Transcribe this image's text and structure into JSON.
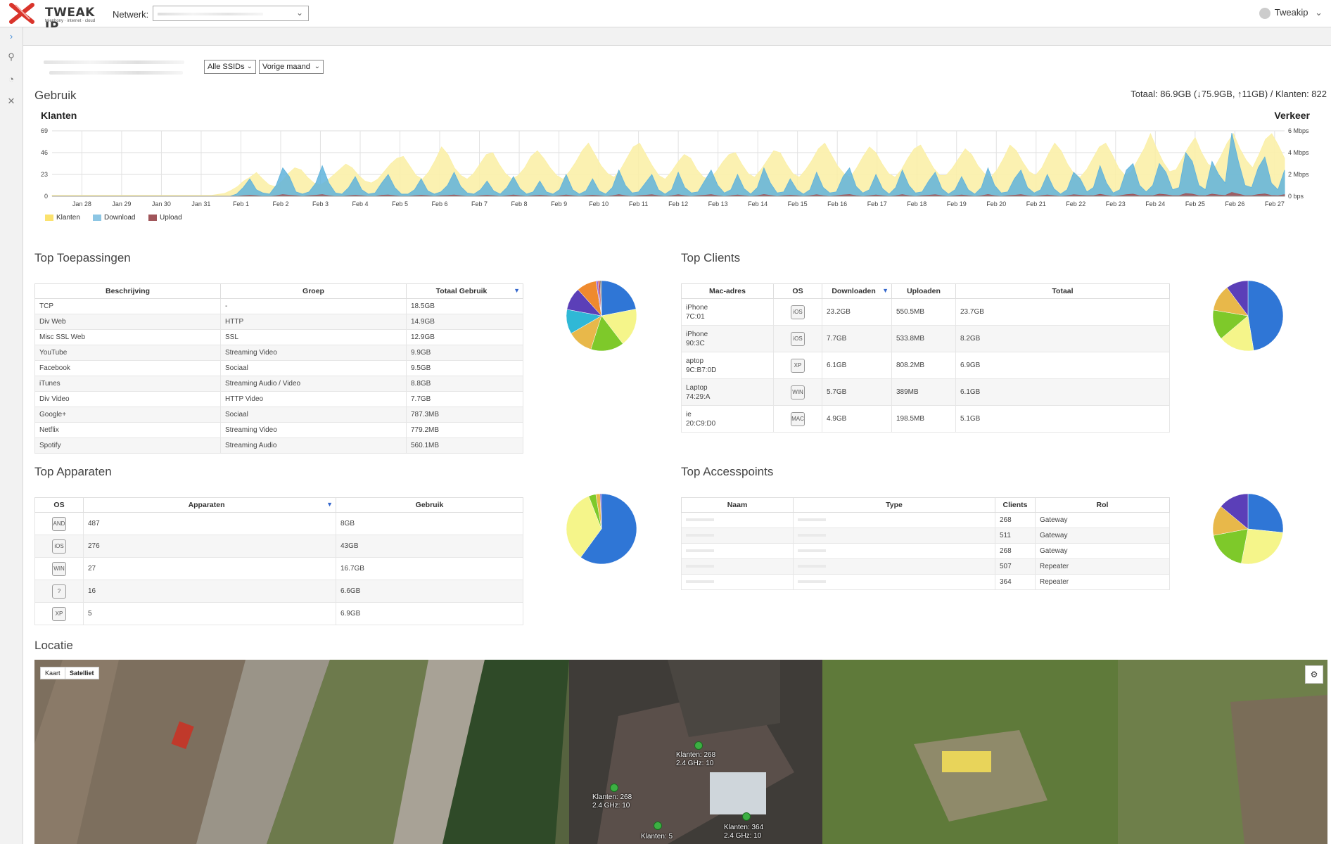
{
  "header": {
    "logo_text": "TWEAK IP",
    "logo_sub": "telephony · internet · cloud",
    "network_label": "Netwerk:",
    "user_name": "Tweakip"
  },
  "filters": {
    "ssid": "Alle SSIDs",
    "period": "Vorige maand"
  },
  "usage": {
    "title": "Gebruik",
    "totals": "Totaal: 86.9GB (↓75.9GB, ↑11GB) / Klanten: 822"
  },
  "chart_data": {
    "type": "area",
    "title": "",
    "left_axis_label": "Klanten",
    "right_axis_label": "Verkeer",
    "left_ticks": [
      "69",
      "46",
      "23",
      "0"
    ],
    "right_ticks": [
      "6 Mbps",
      "4 Mbps",
      "2 Mbps",
      "0 bps"
    ],
    "ylim_left": [
      0,
      69
    ],
    "ylim_right_mbps": [
      0,
      6
    ],
    "x_labels": [
      "Jan 28",
      "Jan 29",
      "Jan 30",
      "Jan 31",
      "Feb 1",
      "Feb 2",
      "Feb 3",
      "Feb 4",
      "Feb 5",
      "Feb 6",
      "Feb 7",
      "Feb 8",
      "Feb 9",
      "Feb 10",
      "Feb 11",
      "Feb 12",
      "Feb 13",
      "Feb 14",
      "Feb 15",
      "Feb 16",
      "Feb 17",
      "Feb 18",
      "Feb 19",
      "Feb 20",
      "Feb 21",
      "Feb 22",
      "Feb 23",
      "Feb 24",
      "Feb 25",
      "Feb 26",
      "Feb 27"
    ],
    "series": [
      {
        "name": "Klanten",
        "color": "#fbf0a8",
        "values": [
          1,
          1,
          1,
          1,
          1,
          1,
          1,
          1,
          1,
          1,
          1,
          1,
          1,
          1,
          1,
          1,
          1,
          1,
          1,
          1,
          1,
          1,
          1,
          1,
          1,
          1,
          2,
          3,
          6,
          10,
          16,
          20,
          25,
          18,
          12,
          10,
          16,
          24,
          30,
          28,
          20,
          14,
          12,
          16,
          22,
          28,
          34,
          30,
          22,
          16,
          14,
          18,
          26,
          34,
          40,
          42,
          32,
          22,
          18,
          26,
          38,
          52,
          44,
          30,
          22,
          18,
          24,
          34,
          44,
          46,
          34,
          24,
          18,
          22,
          30,
          42,
          48,
          40,
          30,
          22,
          18,
          26,
          36,
          48,
          56,
          44,
          32,
          24,
          20,
          28,
          40,
          52,
          56,
          44,
          32,
          22,
          18,
          26,
          36,
          44,
          40,
          28,
          20,
          18,
          26,
          36,
          44,
          46,
          34,
          24,
          20,
          28,
          38,
          48,
          46,
          34,
          24,
          20,
          28,
          38,
          50,
          56,
          44,
          32,
          24,
          20,
          30,
          42,
          52,
          46,
          34,
          24,
          20,
          28,
          40,
          50,
          54,
          42,
          30,
          22,
          22,
          30,
          40,
          50,
          44,
          32,
          24,
          20,
          28,
          40,
          54,
          48,
          36,
          26,
          22,
          30,
          44,
          56,
          48,
          34,
          24,
          20,
          28,
          40,
          52,
          56,
          44,
          30,
          22,
          26,
          38,
          50,
          66,
          50,
          36,
          26,
          28,
          40,
          52,
          62,
          46,
          34,
          30,
          42,
          56,
          66,
          50,
          38,
          30,
          44,
          60,
          66,
          54,
          40
        ]
      },
      {
        "name": "Download",
        "color": "#9fcfe8",
        "values": [
          0,
          0,
          0,
          0,
          0,
          0,
          0,
          0,
          0,
          0,
          0,
          0,
          0,
          0,
          0,
          0,
          0,
          0,
          0,
          0,
          0,
          0,
          0,
          0,
          0,
          0,
          0,
          0,
          0.2,
          0.8,
          1.6,
          0.6,
          0.3,
          0.2,
          1.0,
          2.6,
          1.8,
          0.4,
          0.2,
          0.4,
          1.2,
          2.8,
          1.2,
          0.3,
          0.2,
          0.8,
          1.8,
          0.6,
          0.2,
          0.3,
          1.2,
          2.0,
          0.8,
          0.2,
          0.2,
          0.6,
          1.6,
          0.5,
          0.2,
          0.4,
          1.0,
          2.2,
          0.9,
          0.3,
          0.2,
          0.6,
          1.4,
          0.5,
          0.2,
          0.8,
          1.8,
          0.7,
          0.2,
          0.4,
          1.4,
          0.4,
          0.2,
          0.6,
          2.0,
          0.6,
          0.2,
          0.5,
          1.6,
          0.5,
          0.2,
          0.8,
          2.4,
          1.0,
          0.3,
          0.4,
          1.2,
          2.0,
          0.6,
          0.2,
          0.6,
          2.2,
          0.8,
          0.3,
          0.4,
          1.4,
          2.4,
          1.0,
          0.3,
          0.6,
          2.0,
          0.7,
          0.2,
          0.8,
          2.6,
          1.2,
          0.3,
          0.4,
          1.6,
          0.6,
          0.2,
          0.6,
          2.2,
          0.8,
          0.3,
          0.4,
          1.8,
          2.6,
          0.9,
          0.3,
          0.6,
          2.0,
          0.7,
          0.2,
          0.8,
          2.4,
          1.0,
          0.3,
          0.4,
          1.4,
          2.2,
          0.7,
          0.2,
          0.6,
          1.8,
          0.6,
          0.2,
          0.8,
          2.6,
          1.0,
          0.3,
          0.4,
          1.6,
          2.4,
          0.8,
          0.3,
          0.6,
          2.0,
          0.7,
          0.2,
          0.6,
          2.2,
          1.6,
          0.4,
          0.8,
          2.8,
          1.2,
          0.3,
          0.6,
          2.4,
          3.0,
          1.0,
          0.4,
          1.0,
          3.0,
          2.2,
          0.6,
          0.8,
          4.0,
          3.2,
          1.0,
          0.6,
          3.2,
          2.0,
          1.2,
          5.8,
          3.2,
          1.0,
          0.8,
          2.6,
          3.6,
          1.2,
          0.6,
          2.4
        ]
      },
      {
        "name": "Upload",
        "color": "#a0555a",
        "values": [
          0,
          0,
          0,
          0,
          0,
          0,
          0,
          0,
          0,
          0,
          0,
          0,
          0,
          0,
          0,
          0,
          0,
          0,
          0,
          0,
          0,
          0,
          0,
          0,
          0,
          0,
          0,
          0,
          0,
          0.05,
          0.1,
          0.05,
          0,
          0,
          0.05,
          0.15,
          0.1,
          0.05,
          0,
          0.05,
          0.1,
          0.15,
          0.05,
          0,
          0,
          0.05,
          0.1,
          0.05,
          0,
          0,
          0.1,
          0.12,
          0.05,
          0,
          0,
          0.05,
          0.1,
          0.05,
          0,
          0.05,
          0.08,
          0.12,
          0.05,
          0,
          0,
          0.05,
          0.1,
          0.05,
          0,
          0.05,
          0.12,
          0.05,
          0,
          0.05,
          0.1,
          0.05,
          0,
          0.05,
          0.12,
          0.05,
          0,
          0.05,
          0.1,
          0.05,
          0,
          0.05,
          0.15,
          0.06,
          0,
          0.05,
          0.1,
          0.14,
          0.05,
          0,
          0.05,
          0.14,
          0.05,
          0,
          0.05,
          0.1,
          0.15,
          0.06,
          0,
          0.05,
          0.12,
          0.05,
          0,
          0.05,
          0.16,
          0.08,
          0,
          0.05,
          0.1,
          0.05,
          0,
          0.05,
          0.14,
          0.05,
          0,
          0.05,
          0.12,
          0.16,
          0.06,
          0,
          0.05,
          0.12,
          0.05,
          0,
          0.05,
          0.15,
          0.06,
          0,
          0.05,
          0.1,
          0.14,
          0.05,
          0,
          0.05,
          0.12,
          0.05,
          0,
          0.05,
          0.16,
          0.06,
          0,
          0.05,
          0.1,
          0.15,
          0.05,
          0,
          0.05,
          0.12,
          0.05,
          0,
          0.05,
          0.14,
          0.1,
          0.05,
          0.05,
          0.18,
          0.08,
          0,
          0.05,
          0.15,
          0.2,
          0.06,
          0.05,
          0.06,
          0.2,
          0.14,
          0.05,
          0.06,
          0.25,
          0.2,
          0.06,
          0.05,
          0.2,
          0.12,
          0.08,
          0.35,
          0.2,
          0.06,
          0.05,
          0.16,
          0.22,
          0.08,
          0.05,
          0.15
        ]
      }
    ],
    "legend_placement": "bottom-left",
    "grid": true
  },
  "apps": {
    "title": "Top Toepassingen",
    "columns": [
      "Beschrijving",
      "Groep",
      "Totaal Gebruik"
    ],
    "rows": [
      [
        "TCP",
        "-",
        "18.5GB"
      ],
      [
        "Div Web",
        "HTTP",
        "14.9GB"
      ],
      [
        "Misc SSL Web",
        "SSL",
        "12.9GB"
      ],
      [
        "YouTube",
        "Streaming Video",
        "9.9GB"
      ],
      [
        "Facebook",
        "Sociaal",
        "9.5GB"
      ],
      [
        "iTunes",
        "Streaming Audio / Video",
        "8.8GB"
      ],
      [
        "Div Video",
        "HTTP Video",
        "7.7GB"
      ],
      [
        "Google+",
        "Sociaal",
        "787.3MB"
      ],
      [
        "Netflix",
        "Streaming Video",
        "779.2MB"
      ],
      [
        "Spotify",
        "Streaming Audio",
        "560.1MB"
      ]
    ],
    "pie": [
      {
        "value": 18.5,
        "color": "#2f76d6"
      },
      {
        "value": 14.9,
        "color": "#f5f58a"
      },
      {
        "value": 12.9,
        "color": "#7ec92a"
      },
      {
        "value": 9.9,
        "color": "#e8b84a"
      },
      {
        "value": 9.5,
        "color": "#2fb8d6"
      },
      {
        "value": 8.8,
        "color": "#5b3fb8"
      },
      {
        "value": 7.7,
        "color": "#ef8a2e"
      },
      {
        "value": 0.79,
        "color": "#9a6ad6"
      },
      {
        "value": 0.78,
        "color": "#c24a4a"
      },
      {
        "value": 0.56,
        "color": "#6a6a6a"
      }
    ]
  },
  "clients": {
    "title": "Top Clients",
    "columns": [
      "Mac-adres",
      "OS",
      "Downloaden",
      "Uploaden",
      "Totaal"
    ],
    "rows": [
      {
        "mac1": "iPhone",
        "mac2": "7C:01",
        "os": "iOS",
        "down": "23.2GB",
        "up": "550.5MB",
        "total": "23.7GB"
      },
      {
        "mac1": "iPhone",
        "mac2": "90:3C",
        "os": "iOS",
        "down": "7.7GB",
        "up": "533.8MB",
        "total": "8.2GB"
      },
      {
        "mac1": "aptop",
        "mac2": "9C:B7:0D",
        "os": "XP",
        "down": "6.1GB",
        "up": "808.2MB",
        "total": "6.9GB"
      },
      {
        "mac1": "Laptop",
        "mac2": "74:29:A",
        "os": "WIN",
        "down": "5.7GB",
        "up": "389MB",
        "total": "6.1GB"
      },
      {
        "mac1": "ie",
        "mac2": "20:C9:D0",
        "os": "MAC",
        "down": "4.9GB",
        "up": "198.5MB",
        "total": "5.1GB"
      }
    ],
    "pie": [
      {
        "value": 23.7,
        "color": "#2f76d6"
      },
      {
        "value": 8.2,
        "color": "#f5f58a"
      },
      {
        "value": 6.9,
        "color": "#7ec92a"
      },
      {
        "value": 6.1,
        "color": "#e8b84a"
      },
      {
        "value": 5.1,
        "color": "#5b3fb8"
      }
    ]
  },
  "devices": {
    "title": "Top Apparaten",
    "columns": [
      "OS",
      "Apparaten",
      "Gebruik"
    ],
    "rows": [
      {
        "os": "AND",
        "count": "487",
        "usage": "8GB"
      },
      {
        "os": "iOS",
        "count": "276",
        "usage": "43GB"
      },
      {
        "os": "WIN",
        "count": "27",
        "usage": "16.7GB"
      },
      {
        "os": "?",
        "count": "16",
        "usage": "6.6GB"
      },
      {
        "os": "XP",
        "count": "5",
        "usage": "6.9GB"
      }
    ],
    "pie": [
      {
        "value": 487,
        "color": "#2f76d6"
      },
      {
        "value": 276,
        "color": "#f5f58a"
      },
      {
        "value": 27,
        "color": "#7ec92a"
      },
      {
        "value": 16,
        "color": "#e8b84a"
      },
      {
        "value": 5,
        "color": "#5b3fb8"
      }
    ]
  },
  "accesspoints": {
    "title": "Top Accesspoints",
    "columns": [
      "Naam",
      "Type",
      "Clients",
      "Rol"
    ],
    "rows": [
      {
        "name": "",
        "type": "",
        "clients": "268",
        "role": "Gateway"
      },
      {
        "name": "",
        "type": "",
        "clients": "511",
        "role": "Gateway"
      },
      {
        "name": "",
        "type": "",
        "clients": "268",
        "role": "Gateway"
      },
      {
        "name": "",
        "type": "",
        "clients": "507",
        "role": "Repeater"
      },
      {
        "name": "",
        "type": "",
        "clients": "364",
        "role": "Repeater"
      }
    ],
    "pie": [
      {
        "value": 511,
        "color": "#2f76d6"
      },
      {
        "value": 507,
        "color": "#f5f58a"
      },
      {
        "value": 364,
        "color": "#7ec92a"
      },
      {
        "value": 268,
        "color": "#e8b84a"
      },
      {
        "value": 268,
        "color": "#5b3fb8"
      }
    ]
  },
  "location": {
    "title": "Locatie",
    "map_btn_kaart": "Kaart",
    "map_btn_satelliet": "Satelliet",
    "markers": [
      {
        "label": "Klanten: 268\n2.4 GHz: 10"
      },
      {
        "label": "Klanten: 268\n2.4 GHz: 10"
      },
      {
        "label": "Klanten: 364\n2.4 GHz: 10"
      },
      {
        "label": "Klanten: 5"
      }
    ]
  }
}
